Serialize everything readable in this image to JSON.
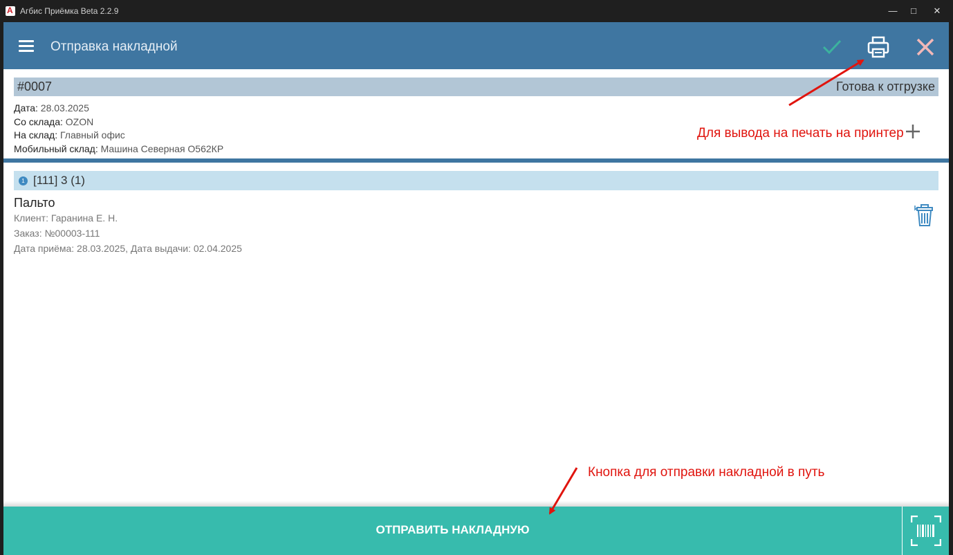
{
  "window": {
    "title": "Агбис Приёмка Beta 2.2.9",
    "minimize_glyph": "—",
    "maximize_glyph": "□",
    "close_glyph": "✕"
  },
  "appbar": {
    "title": "Отправка накладной",
    "icons": [
      "menu-icon",
      "check-icon",
      "printer-icon",
      "close-icon"
    ],
    "color": "#3f76a1"
  },
  "invoice": {
    "number": "#0007",
    "status": "Готова к отгрузке",
    "date_label": "Дата:",
    "date_value": "28.03.2025",
    "from_label": "Со склада:",
    "from_value": "OZON",
    "to_label": "На склад:",
    "to_value": "Главный офис",
    "mobile_label": "Мобильный склад:",
    "mobile_value": "Машина Северная О562КР"
  },
  "group": {
    "badge": "1",
    "title": "[111] 3 (1)"
  },
  "item": {
    "name": "Пальто",
    "client": "Клиент: Гаранина Е. Н.",
    "order": "Заказ: №00003-111",
    "dates": "Дата приёма: 28.03.2025, Дата выдачи: 02.04.2025"
  },
  "annotations": {
    "print_hint": "Для вывода на печать на принтер",
    "send_hint": "Кнопка для отправки накладной в путь",
    "color": "#e0140e"
  },
  "bottom": {
    "send_label": "ОТПРАВИТЬ НАКЛАДНУЮ",
    "color": "#37bbad"
  }
}
